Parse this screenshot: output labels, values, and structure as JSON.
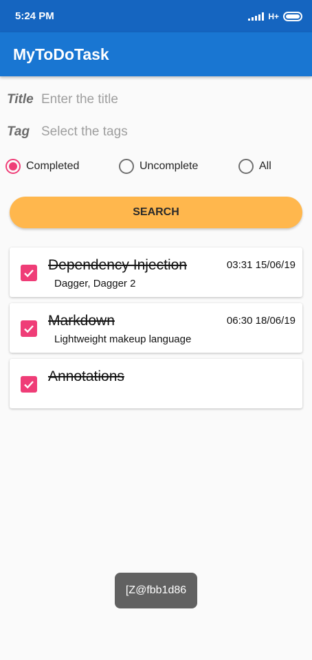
{
  "status_bar": {
    "time": "5:24 PM",
    "network": "H+"
  },
  "app_bar": {
    "title": "MyToDoTask"
  },
  "form": {
    "title_label": "Title",
    "title_placeholder": "Enter the title",
    "tag_label": "Tag",
    "tag_placeholder": "Select the tags"
  },
  "filters": {
    "selected": "Completed",
    "options": [
      "Completed",
      "Uncomplete",
      "All"
    ]
  },
  "search_button": {
    "label": "SEARCH"
  },
  "tasks": [
    {
      "title": "Dependency Injection",
      "date": "03:31 15/06/19",
      "tags": "Dagger, Dagger 2",
      "checked": true
    },
    {
      "title": "Markdown",
      "date": "06:30 18/06/19",
      "tags": "Lightweight makeup language",
      "checked": true
    },
    {
      "title": "Annotations",
      "date": "",
      "tags": "",
      "checked": true
    }
  ],
  "toast": {
    "text": "[Z@fbb1d86"
  },
  "colors": {
    "status_bar": "#1565c0",
    "app_bar": "#1976d2",
    "accent": "#ef3d77",
    "search_button": "#ffb74d",
    "toast": "#616161"
  }
}
